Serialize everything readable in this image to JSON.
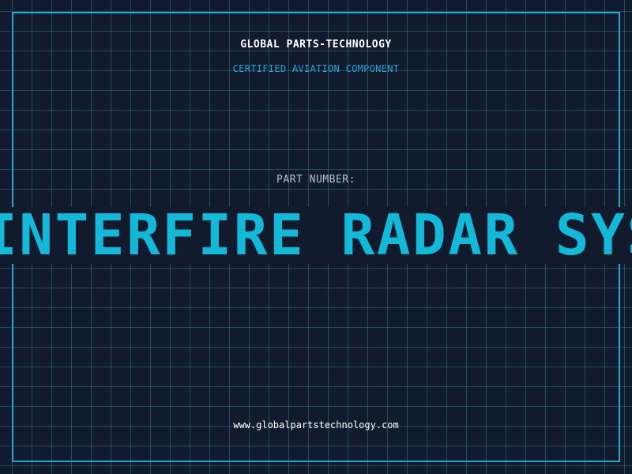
{
  "colors": {
    "background": "#121a2e",
    "grid": "#2a6a86",
    "frame": "#1ea8d0",
    "accent": "#14b8d8",
    "subtitle": "#2aa7d6",
    "text_light": "#ffffff",
    "label": "#b4c2d2"
  },
  "header": {
    "brand": "GLOBAL PARTS-TECHNOLOGY",
    "subtitle": "CERTIFIED AVIATION COMPONENT"
  },
  "main": {
    "part_label": "PART NUMBER:",
    "part_banner": "INTERFIRE RADAR SYSTEM"
  },
  "footer": {
    "url": "www.globalpartstechnology.com"
  }
}
